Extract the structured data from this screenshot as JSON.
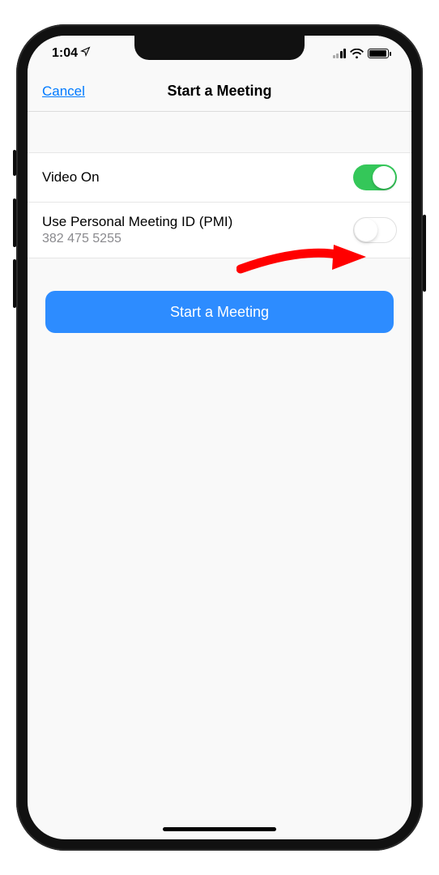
{
  "status": {
    "time": "1:04"
  },
  "nav": {
    "cancel": "Cancel",
    "title": "Start a Meeting"
  },
  "settings": {
    "video_label": "Video On",
    "pmi_label": "Use Personal Meeting ID (PMI)",
    "pmi_value": "382 475 5255"
  },
  "action": {
    "start": "Start a Meeting"
  }
}
